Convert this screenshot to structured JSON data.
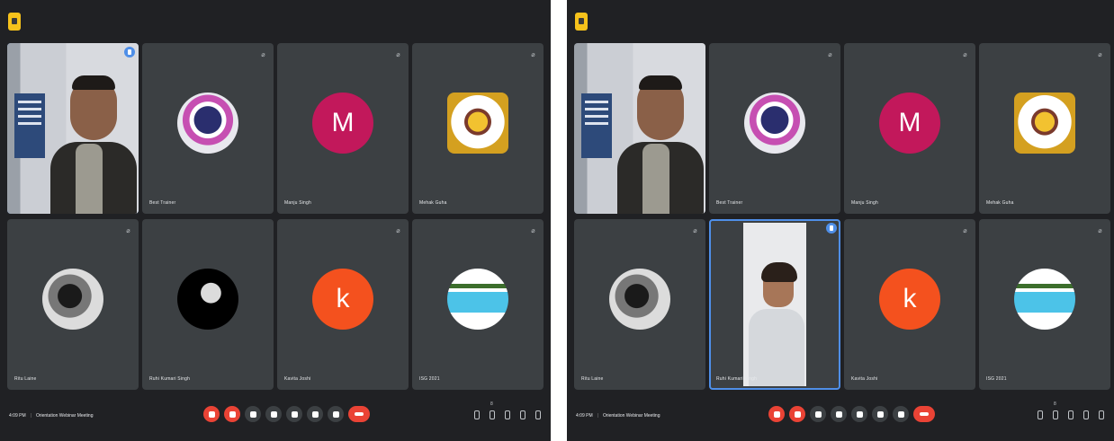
{
  "screens": [
    {
      "meeting": {
        "time": "4:09 PM",
        "title": "Orientation Webinar Meeting"
      },
      "people_badge": "8",
      "tiles": [
        {
          "name": "",
          "kind": "video-host",
          "active": true
        },
        {
          "name": "Best Trainer",
          "kind": "logo1"
        },
        {
          "name": "Manju Singh",
          "kind": "letter",
          "letter": "M",
          "color": "#c2185b"
        },
        {
          "name": "Mehak Guha",
          "kind": "logo2"
        },
        {
          "name": "Ritu Laine",
          "kind": "bw1"
        },
        {
          "name": "Ruhi Kumari Singh",
          "kind": "bw2"
        },
        {
          "name": "Kavita Joshi",
          "kind": "letter",
          "letter": "k",
          "color": "#f4511e"
        },
        {
          "name": "ISG 2021",
          "kind": "logo3"
        }
      ]
    },
    {
      "meeting": {
        "time": "4:09 PM",
        "title": "Orientation Webinar Meeting"
      },
      "people_badge": "8",
      "tiles": [
        {
          "name": "",
          "kind": "video-host"
        },
        {
          "name": "Best Trainer",
          "kind": "logo1"
        },
        {
          "name": "Manju Singh",
          "kind": "letter",
          "letter": "M",
          "color": "#c2185b"
        },
        {
          "name": "Mehak Guha",
          "kind": "logo2"
        },
        {
          "name": "Ritu Laine",
          "kind": "bw1"
        },
        {
          "name": "Ruhi Kumari Singh",
          "kind": "video-guest",
          "active": true
        },
        {
          "name": "Kavita Joshi",
          "kind": "letter",
          "letter": "k",
          "color": "#f4511e"
        },
        {
          "name": "ISG 2021",
          "kind": "logo3"
        }
      ]
    }
  ],
  "icons": {
    "mute": "mic-off-icon",
    "controls": [
      "mic-off-icon",
      "camera-off-icon",
      "captions-icon",
      "raise-hand-icon",
      "present-icon",
      "more-options-icon",
      "end-call-icon"
    ],
    "right": [
      "info-icon",
      "people-icon",
      "chat-icon",
      "activities-icon",
      "host-controls-icon"
    ]
  },
  "colors": {
    "background": "#202124",
    "tile": "#3c4043",
    "accent": "#4f8fe8",
    "danger": "#ea4335"
  }
}
